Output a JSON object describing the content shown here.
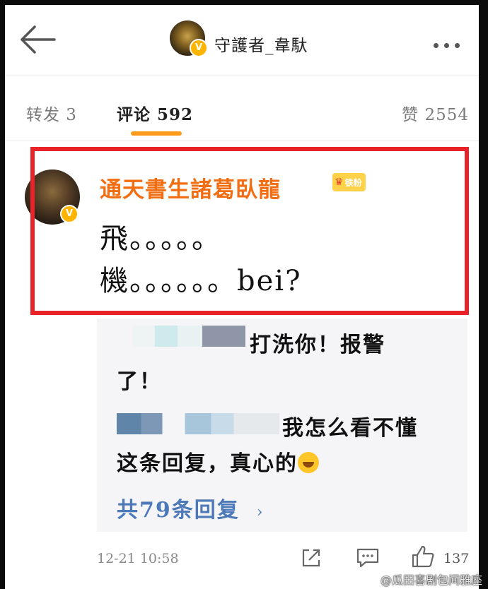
{
  "header": {
    "title": "守護者_韋馱",
    "back_icon": "arrow-left-icon",
    "more_icon": "more-horizontal-icon",
    "verified_badge": "V"
  },
  "tabs": [
    {
      "label": "转发 3"
    },
    {
      "label": "评论 592"
    },
    {
      "label": "赞 2554"
    }
  ],
  "comment": {
    "username": "通天書生諸葛臥龍",
    "fan_badge": "铁粉",
    "verified_badge": "V",
    "lines": [
      "飛。。。。。",
      "機。。。。。。bei?"
    ],
    "highlight_color": "#e8232a"
  },
  "replies": {
    "reply1_part1": "打洗你！报警",
    "reply1_part2": "了！",
    "reply2_part1": "我怎么看不懂",
    "reply2_part2": "这条回复，真心的",
    "more_label": "共79条回复",
    "more_chevron": "›"
  },
  "footer": {
    "timestamp": "12-21 10:58",
    "like_count": "137"
  },
  "watermark": "@瓜田喜剧包间雅座",
  "colors": {
    "accent": "#ff9a1a",
    "username": "#f26e12",
    "link": "#4d79b8"
  }
}
